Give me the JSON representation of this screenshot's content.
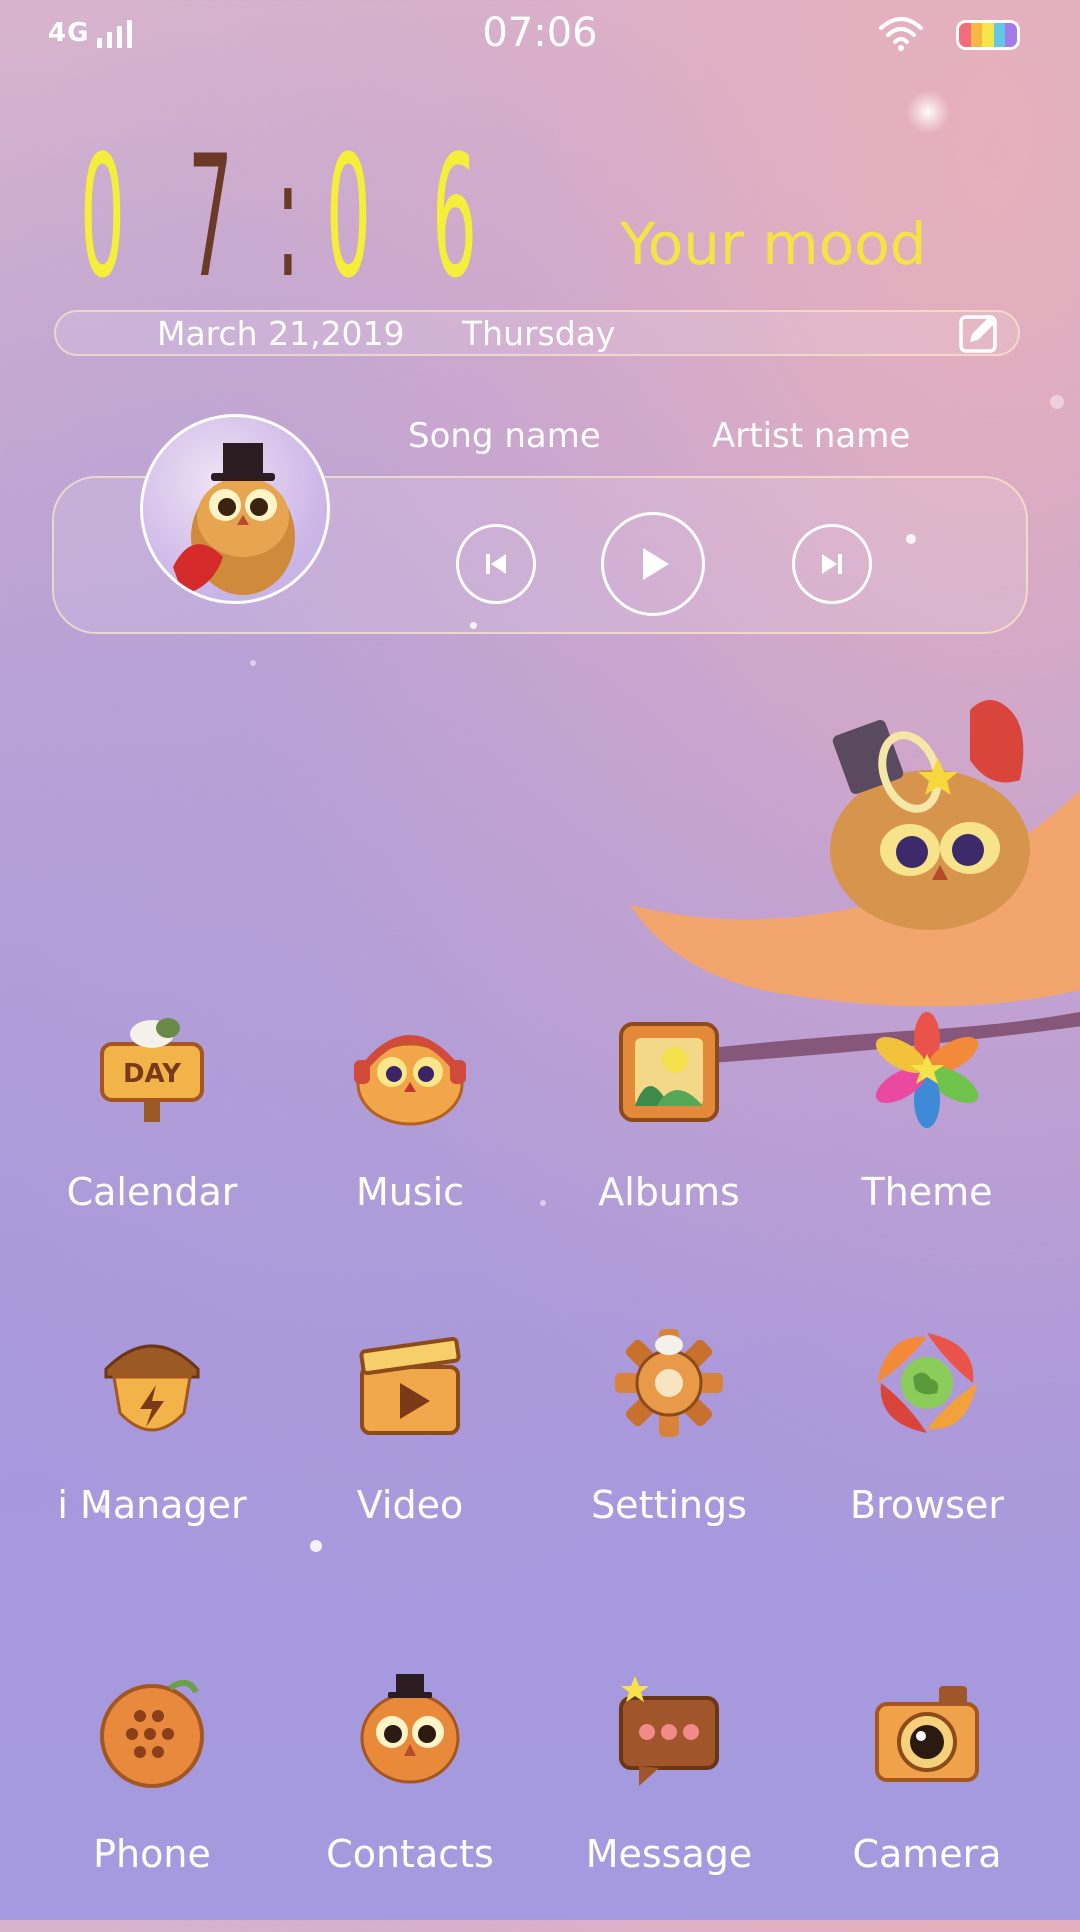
{
  "status_bar": {
    "network": "4G",
    "time": "07:06"
  },
  "clock_widget": {
    "digits": [
      "0",
      "7",
      ":",
      "0",
      "6"
    ],
    "mood": "Your mood",
    "date": "March 21,2019",
    "weekday": "Thursday"
  },
  "music_widget": {
    "song_name": "Song name",
    "artist_name": "Artist name"
  },
  "apps": [
    {
      "label": "Calendar",
      "icon": "calendar-day-sign-icon"
    },
    {
      "label": "Music",
      "icon": "owl-headphones-icon"
    },
    {
      "label": "Albums",
      "icon": "picture-frame-icon"
    },
    {
      "label": "Theme",
      "icon": "feather-flower-icon"
    },
    {
      "label": "i Manager",
      "icon": "acorn-lightning-icon"
    },
    {
      "label": "Video",
      "icon": "clapperboard-icon"
    },
    {
      "label": "Settings",
      "icon": "wooden-gear-icon"
    },
    {
      "label": "Browser",
      "icon": "swirl-globe-icon"
    },
    {
      "label": "Phone",
      "icon": "dialpad-ball-icon"
    },
    {
      "label": "Contacts",
      "icon": "owl-face-icon"
    },
    {
      "label": "Message",
      "icon": "chat-bubble-icon"
    },
    {
      "label": "Camera",
      "icon": "camera-icon"
    }
  ],
  "colors": {
    "clock_yellow": "#f5ee3a",
    "clock_brown": "#6b3a26",
    "mood_yellow": "#f5e446",
    "icon_orange": "#e98a3a"
  }
}
